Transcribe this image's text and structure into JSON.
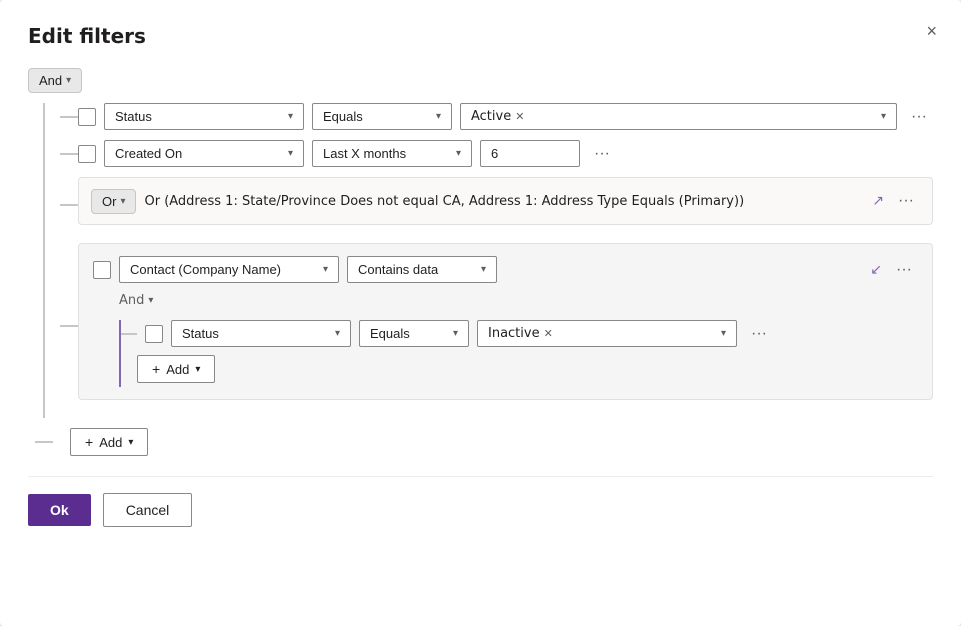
{
  "dialog": {
    "title": "Edit filters",
    "close_label": "×"
  },
  "top_logic": {
    "label": "And",
    "chevron": "▾"
  },
  "rows": [
    {
      "field": "Status",
      "operator": "Equals",
      "value_tag": "Active",
      "has_tag": true,
      "input_value": ""
    },
    {
      "field": "Created On",
      "operator": "Last X months",
      "has_tag": false,
      "input_value": "6"
    }
  ],
  "or_group": {
    "logic": "Or",
    "chevron": "▾",
    "text": "Or (Address 1: State/Province Does not equal CA, Address 1: Address Type Equals (Primary))",
    "expand_icon": "↗"
  },
  "nested_group": {
    "field": "Contact (Company Name)",
    "operator": "Contains data",
    "collapse_icon": "↙",
    "and_logic": "And",
    "and_chevron": "▾",
    "inner_row": {
      "field": "Status",
      "operator": "Equals",
      "value_tag": "Inactive"
    },
    "add_label": "Add",
    "add_chevron": "▾"
  },
  "bottom_add": {
    "label": "Add",
    "chevron": "▾"
  },
  "footer": {
    "ok_label": "Ok",
    "cancel_label": "Cancel"
  }
}
